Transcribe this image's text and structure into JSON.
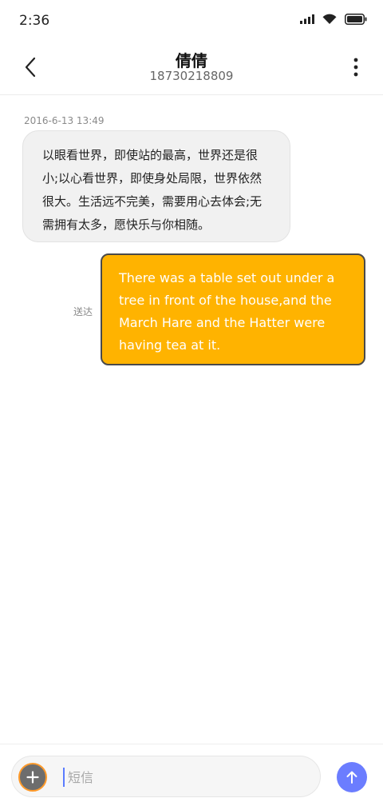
{
  "status_bar": {
    "time": "2:36",
    "icons": [
      "signal-icon",
      "wifi-icon",
      "battery-icon"
    ]
  },
  "header": {
    "contact_name": "倩倩",
    "contact_number": "18730218809",
    "icons": [
      "back-icon",
      "more-vertical-icon"
    ]
  },
  "messages": {
    "timestamp": "2016-6-13 13:49",
    "incoming_text": "以眼看世界，即使站的最高，世界还是很小;以心看世界，即使身处局限，世界依然很大。生活远不完美，需要用心去体会;无需拥有太多，愿快乐与你相随。",
    "outgoing_text": "There was a table set out under a tree in front of the house,and the March Hare and the Hatter were having tea at it.",
    "delivered_label": "送达"
  },
  "composer": {
    "placeholder": "短信",
    "icons": [
      "plus-icon",
      "send-arrow-icon"
    ]
  },
  "colors": {
    "outgoing_bubble": "#ffb300",
    "incoming_bubble": "#f1f1f1",
    "send_button": "#6b7dff",
    "add_button": "#6d6d6d",
    "add_button_ring": "#ff9a2a"
  }
}
